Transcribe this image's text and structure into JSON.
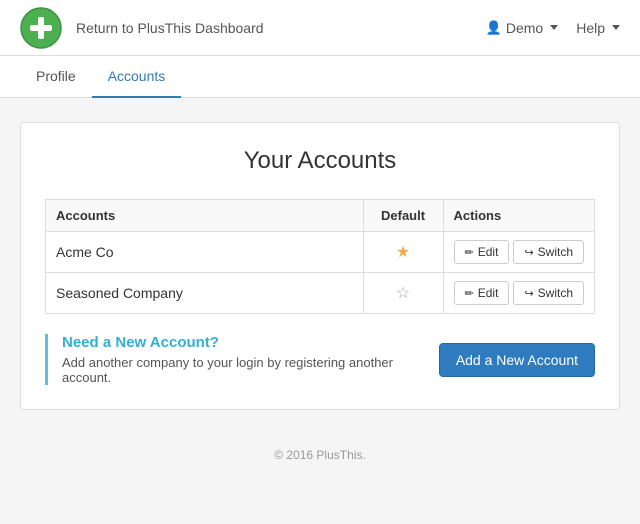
{
  "header": {
    "nav_link": "Return to PlusThis Dashboard",
    "user_label": "Demo",
    "help_label": "Help"
  },
  "tabs": [
    {
      "id": "profile",
      "label": "Profile",
      "active": false
    },
    {
      "id": "accounts",
      "label": "Accounts",
      "active": true
    }
  ],
  "main": {
    "page_title": "Your Accounts",
    "table": {
      "headers": {
        "account": "Accounts",
        "default": "Default",
        "actions": "Actions"
      },
      "rows": [
        {
          "name": "Acme Co",
          "is_default": true,
          "edit_label": "Edit",
          "switch_label": "Switch"
        },
        {
          "name": "Seasoned Company",
          "is_default": false,
          "edit_label": "Edit",
          "switch_label": "Switch"
        }
      ]
    },
    "new_account": {
      "heading": "Need a New Account?",
      "description": "Add another company to your login by registering another account.",
      "button_label": "Add a New Account"
    }
  },
  "footer": {
    "copyright": "© 2016 PlusThis."
  }
}
